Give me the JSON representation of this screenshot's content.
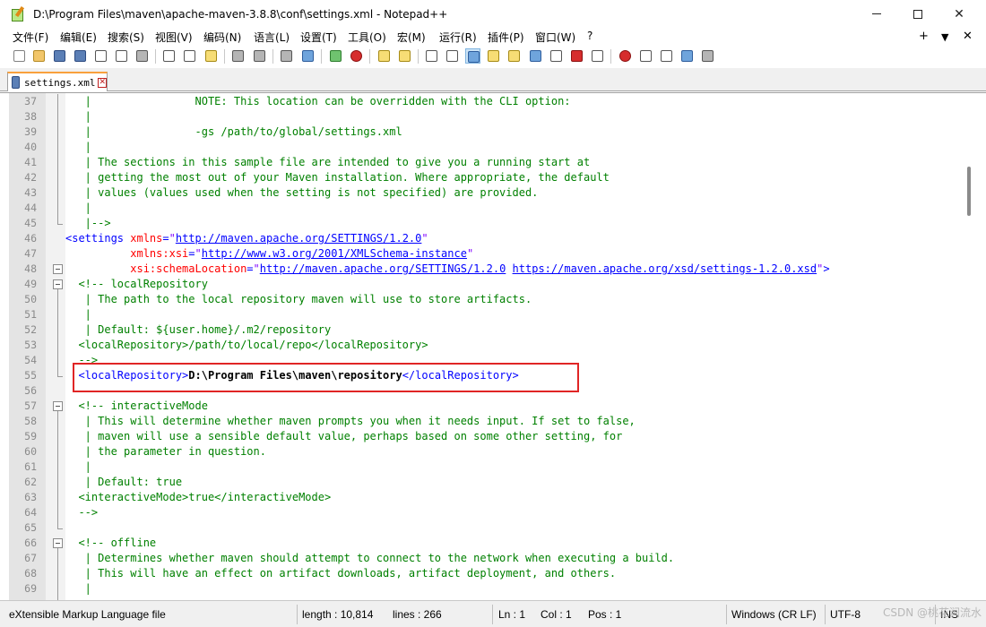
{
  "window": {
    "title": "D:\\Program Files\\maven\\apache-maven-3.8.8\\conf\\settings.xml - Notepad++",
    "minimize_label": "—",
    "maximize_label": "☐",
    "close_label": "✕"
  },
  "menu": {
    "items": [
      "文件(F)",
      "编辑(E)",
      "搜索(S)",
      "视图(V)",
      "编码(N)",
      "语言(L)",
      "设置(T)",
      "工具(O)",
      "宏(M)",
      "运行(R)",
      "插件(P)",
      "窗口(W)",
      "?"
    ],
    "right_plus": "+",
    "right_arrow": "▼",
    "right_close": "✕"
  },
  "toolbar": {
    "icons": [
      "new-file-icon",
      "open-file-icon",
      "save-icon",
      "save-all-icon",
      "close-icon",
      "close-all-icon",
      "print-icon",
      "cut-icon",
      "copy-icon",
      "paste-icon",
      "undo-icon",
      "redo-icon",
      "find-icon",
      "replace-icon",
      "zoom-in-icon",
      "zoom-out-icon",
      "sync-vertical-icon",
      "sync-horizontal-icon",
      "word-wrap-icon",
      "show-all-chars-icon",
      "indent-guide-icon",
      "language-icon",
      "doc-map-icon",
      "function-list-icon",
      "folder-workspace-icon",
      "monitoring-icon",
      "record-macro-icon",
      "stop-record-icon",
      "play-macro-icon",
      "run-macro-multiple-icon",
      "save-macro-icon"
    ]
  },
  "tab": {
    "label": "settings.xml",
    "close_label": "✕"
  },
  "editor": {
    "lines": [
      {
        "n": "37",
        "segs": [
          {
            "c": "c-comment",
            "t": "   |                NOTE: This location can be overridden with the CLI option:"
          }
        ]
      },
      {
        "n": "38",
        "segs": [
          {
            "c": "c-comment",
            "t": "   |"
          }
        ]
      },
      {
        "n": "39",
        "segs": [
          {
            "c": "c-comment",
            "t": "   |                -gs /path/to/global/settings.xml"
          }
        ]
      },
      {
        "n": "40",
        "segs": [
          {
            "c": "c-comment",
            "t": "   |"
          }
        ]
      },
      {
        "n": "41",
        "segs": [
          {
            "c": "c-comment",
            "t": "   | The sections in this sample file are intended to give you a running start at"
          }
        ]
      },
      {
        "n": "42",
        "segs": [
          {
            "c": "c-comment",
            "t": "   | getting the most out of your Maven installation. Where appropriate, the default"
          }
        ]
      },
      {
        "n": "43",
        "segs": [
          {
            "c": "c-comment",
            "t": "   | values (values used when the setting is not specified) are provided."
          }
        ]
      },
      {
        "n": "44",
        "segs": [
          {
            "c": "c-comment",
            "t": "   |"
          }
        ]
      },
      {
        "n": "45",
        "segs": [
          {
            "c": "c-comment",
            "t": "   |-->"
          }
        ]
      },
      {
        "n": "46",
        "segs": [
          {
            "c": "c-tag",
            "t": "<settings "
          },
          {
            "c": "c-attr",
            "t": "xmlns"
          },
          {
            "c": "c-tag",
            "t": "="
          },
          {
            "c": "c-val",
            "t": "\""
          },
          {
            "c": "c-url",
            "t": "http://maven.apache.org/SETTINGS/1.2.0"
          },
          {
            "c": "c-val",
            "t": "\""
          }
        ]
      },
      {
        "n": "47",
        "segs": [
          {
            "c": "c-plain",
            "t": "          "
          },
          {
            "c": "c-attr",
            "t": "xmlns:xsi"
          },
          {
            "c": "c-tag",
            "t": "="
          },
          {
            "c": "c-val",
            "t": "\""
          },
          {
            "c": "c-url",
            "t": "http://www.w3.org/2001/XMLSchema-instance"
          },
          {
            "c": "c-val",
            "t": "\""
          }
        ]
      },
      {
        "n": "48",
        "segs": [
          {
            "c": "c-plain",
            "t": "          "
          },
          {
            "c": "c-attr",
            "t": "xsi:schemaLocation"
          },
          {
            "c": "c-tag",
            "t": "="
          },
          {
            "c": "c-val",
            "t": "\""
          },
          {
            "c": "c-url",
            "t": "http://maven.apache.org/SETTINGS/1.2.0"
          },
          {
            "c": "c-val",
            "t": " "
          },
          {
            "c": "c-url",
            "t": "https://maven.apache.org/xsd/settings-1.2.0.xsd"
          },
          {
            "c": "c-val",
            "t": "\""
          },
          {
            "c": "c-tag",
            "t": ">"
          }
        ]
      },
      {
        "n": "49",
        "segs": [
          {
            "c": "c-comment",
            "t": "  <!-- localRepository"
          }
        ]
      },
      {
        "n": "50",
        "segs": [
          {
            "c": "c-comment",
            "t": "   | The path to the local repository maven will use to store artifacts."
          }
        ]
      },
      {
        "n": "51",
        "segs": [
          {
            "c": "c-comment",
            "t": "   |"
          }
        ]
      },
      {
        "n": "52",
        "segs": [
          {
            "c": "c-comment",
            "t": "   | Default: ${user.home}/.m2/repository"
          }
        ]
      },
      {
        "n": "53",
        "segs": [
          {
            "c": "c-comment",
            "t": "  <localRepository>/path/to/local/repo</localRepository>"
          }
        ]
      },
      {
        "n": "54",
        "segs": [
          {
            "c": "c-comment",
            "t": "  -->"
          }
        ]
      },
      {
        "n": "55",
        "segs": [
          {
            "c": "c-plain",
            "t": "  "
          },
          {
            "c": "c-tag",
            "t": "<localRepository>"
          },
          {
            "c": "c-text",
            "t": "D:\\Program Files\\maven\\repository"
          },
          {
            "c": "c-tag",
            "t": "</localRepository>"
          }
        ]
      },
      {
        "n": "56",
        "segs": [
          {
            "c": "c-plain",
            "t": ""
          }
        ]
      },
      {
        "n": "57",
        "segs": [
          {
            "c": "c-comment",
            "t": "  <!-- interactiveMode"
          }
        ]
      },
      {
        "n": "58",
        "segs": [
          {
            "c": "c-comment",
            "t": "   | This will determine whether maven prompts you when it needs input. If set to false,"
          }
        ]
      },
      {
        "n": "59",
        "segs": [
          {
            "c": "c-comment",
            "t": "   | maven will use a sensible default value, perhaps based on some other setting, for"
          }
        ]
      },
      {
        "n": "60",
        "segs": [
          {
            "c": "c-comment",
            "t": "   | the parameter in question."
          }
        ]
      },
      {
        "n": "61",
        "segs": [
          {
            "c": "c-comment",
            "t": "   |"
          }
        ]
      },
      {
        "n": "62",
        "segs": [
          {
            "c": "c-comment",
            "t": "   | Default: true"
          }
        ]
      },
      {
        "n": "63",
        "segs": [
          {
            "c": "c-comment",
            "t": "  <interactiveMode>true</interactiveMode>"
          }
        ]
      },
      {
        "n": "64",
        "segs": [
          {
            "c": "c-comment",
            "t": "  -->"
          }
        ]
      },
      {
        "n": "65",
        "segs": [
          {
            "c": "c-plain",
            "t": ""
          }
        ]
      },
      {
        "n": "66",
        "segs": [
          {
            "c": "c-comment",
            "t": "  <!-- offline"
          }
        ]
      },
      {
        "n": "67",
        "segs": [
          {
            "c": "c-comment",
            "t": "   | Determines whether maven should attempt to connect to the network when executing a build."
          }
        ]
      },
      {
        "n": "68",
        "segs": [
          {
            "c": "c-comment",
            "t": "   | This will have an effect on artifact downloads, artifact deployment, and others."
          }
        ]
      },
      {
        "n": "69",
        "segs": [
          {
            "c": "c-comment",
            "t": "   |"
          }
        ]
      }
    ],
    "fold_markers": [
      "48",
      "49",
      "57",
      "66"
    ]
  },
  "statusbar": {
    "file_type": "eXtensible Markup Language file",
    "length": "length : 10,814",
    "lines": "lines : 266",
    "ln": "Ln : 1",
    "col": "Col : 1",
    "pos": "Pos : 1",
    "eol": "Windows (CR LF)",
    "encoding": "UTF-8",
    "mode": "INS"
  },
  "watermark": "CSDN @桃花涧流水"
}
